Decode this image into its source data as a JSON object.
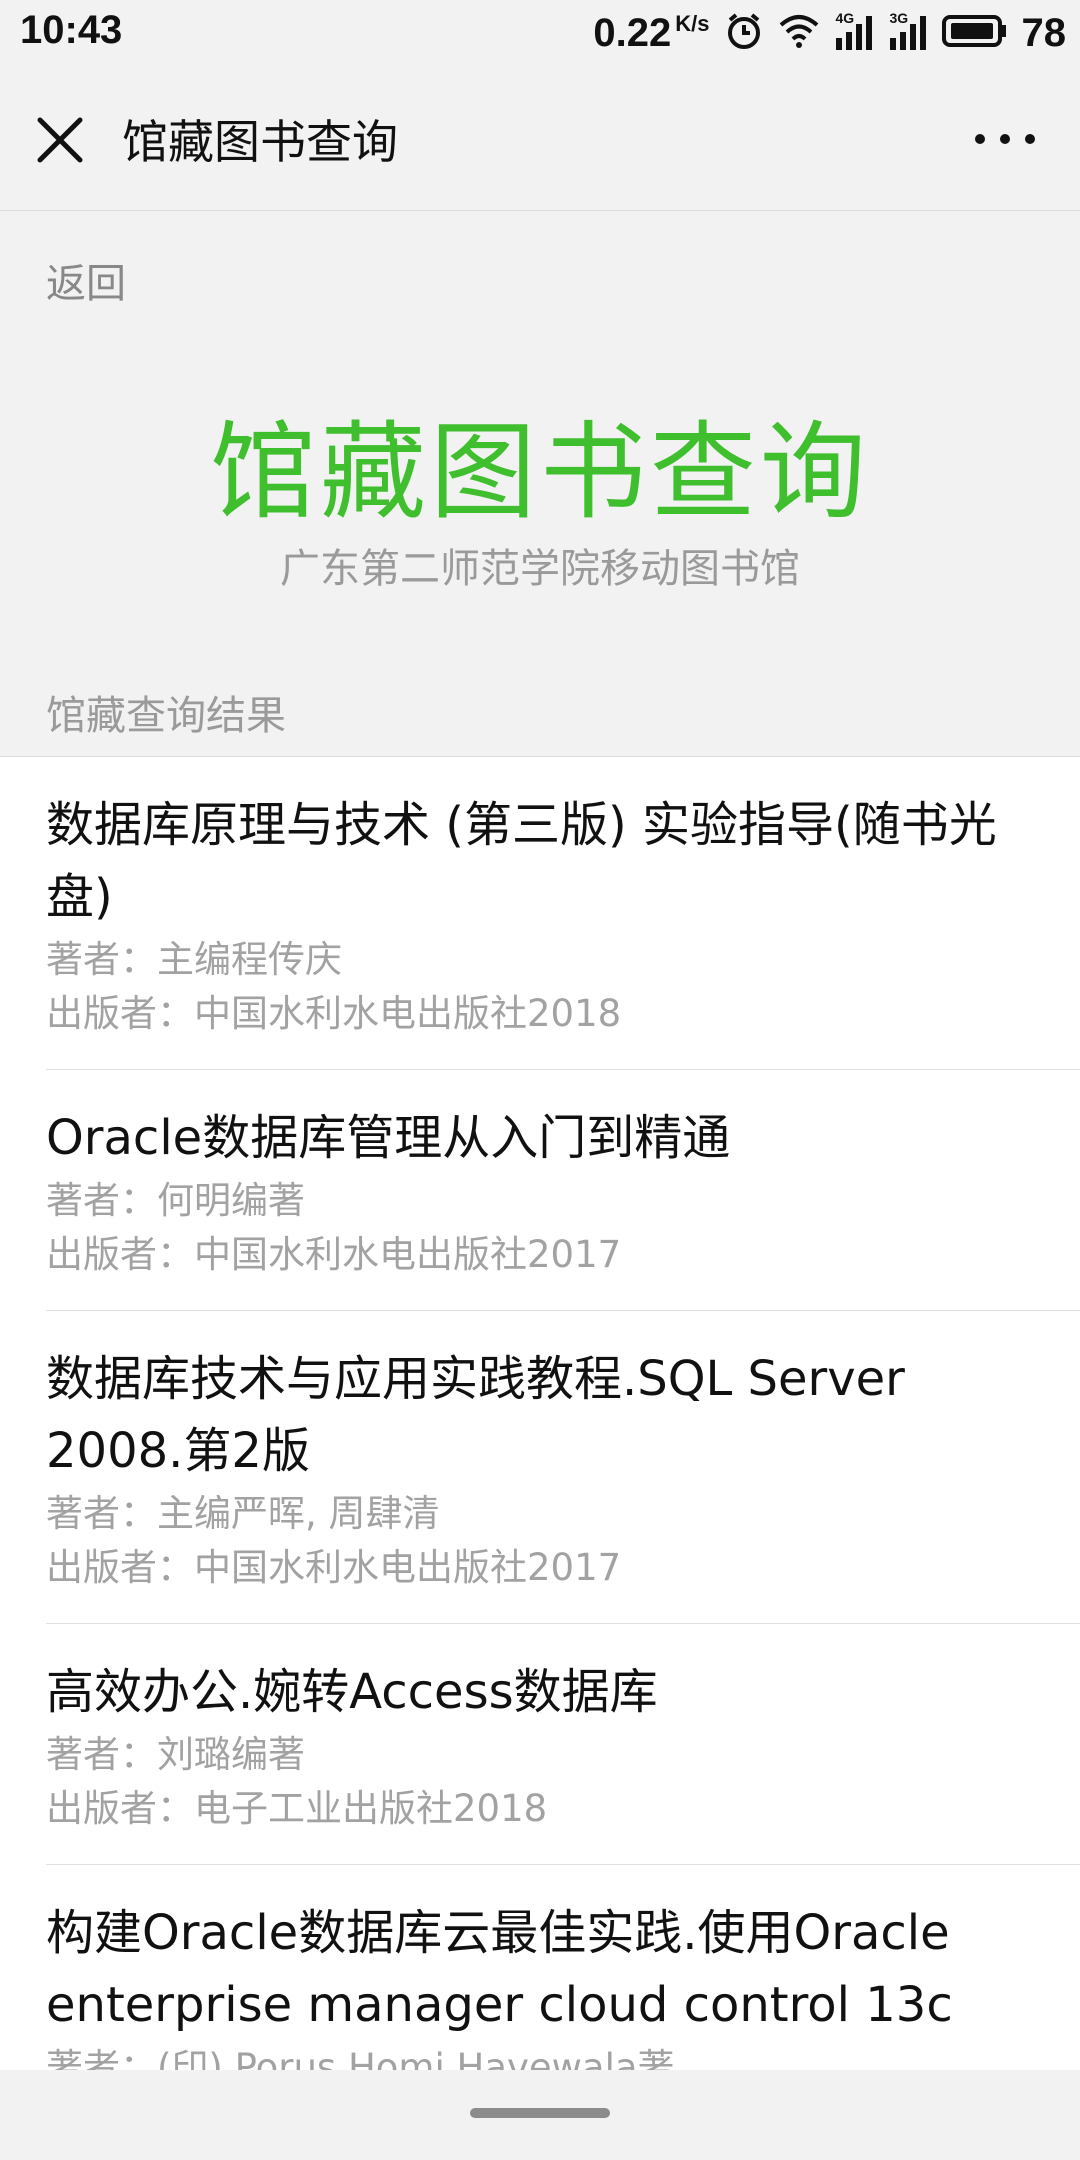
{
  "status_bar": {
    "time": "10:43",
    "net_speed": "0.22",
    "net_speed_unit": "K/s",
    "net_4g": "4G",
    "net_3g": "3G",
    "battery": "78",
    "icons": [
      "alarm-icon",
      "wifi-icon",
      "signal-4g-icon",
      "signal-3g-icon",
      "battery-icon"
    ]
  },
  "nav": {
    "title": "馆藏图书查询",
    "close_icon": "close-icon",
    "more_icon": "more-icon"
  },
  "page": {
    "back_label": "返回",
    "hero_title": "馆藏图书查询",
    "hero_subtitle": "广东第二师范学院移动图书馆",
    "section_title": "馆藏查询结果",
    "accent_color": "#3fbf2d"
  },
  "results": [
    {
      "title": "数据库原理与技术 (第三版) 实验指导(随书光盘)",
      "author": "著者：主编程传庆",
      "publisher": "出版者：中国水利水电出版社2018"
    },
    {
      "title": "Oracle数据库管理从入门到精通",
      "author": "著者：何明编著",
      "publisher": "出版者：中国水利水电出版社2017"
    },
    {
      "title": "数据库技术与应用实践教程.SQL Server 2008.第2版",
      "author": "著者：主编严晖, 周肆清",
      "publisher": "出版者：中国水利水电出版社2017"
    },
    {
      "title": "高效办公.婉转Access数据库",
      "author": "著者：刘璐编著",
      "publisher": "出版者：电子工业出版社2018"
    },
    {
      "title": "构建Oracle数据库云最佳实践.使用Oracle enterprise manager cloud control 13c",
      "author": "著者：(印) Porus Homi Havewala著",
      "publisher": ""
    }
  ]
}
